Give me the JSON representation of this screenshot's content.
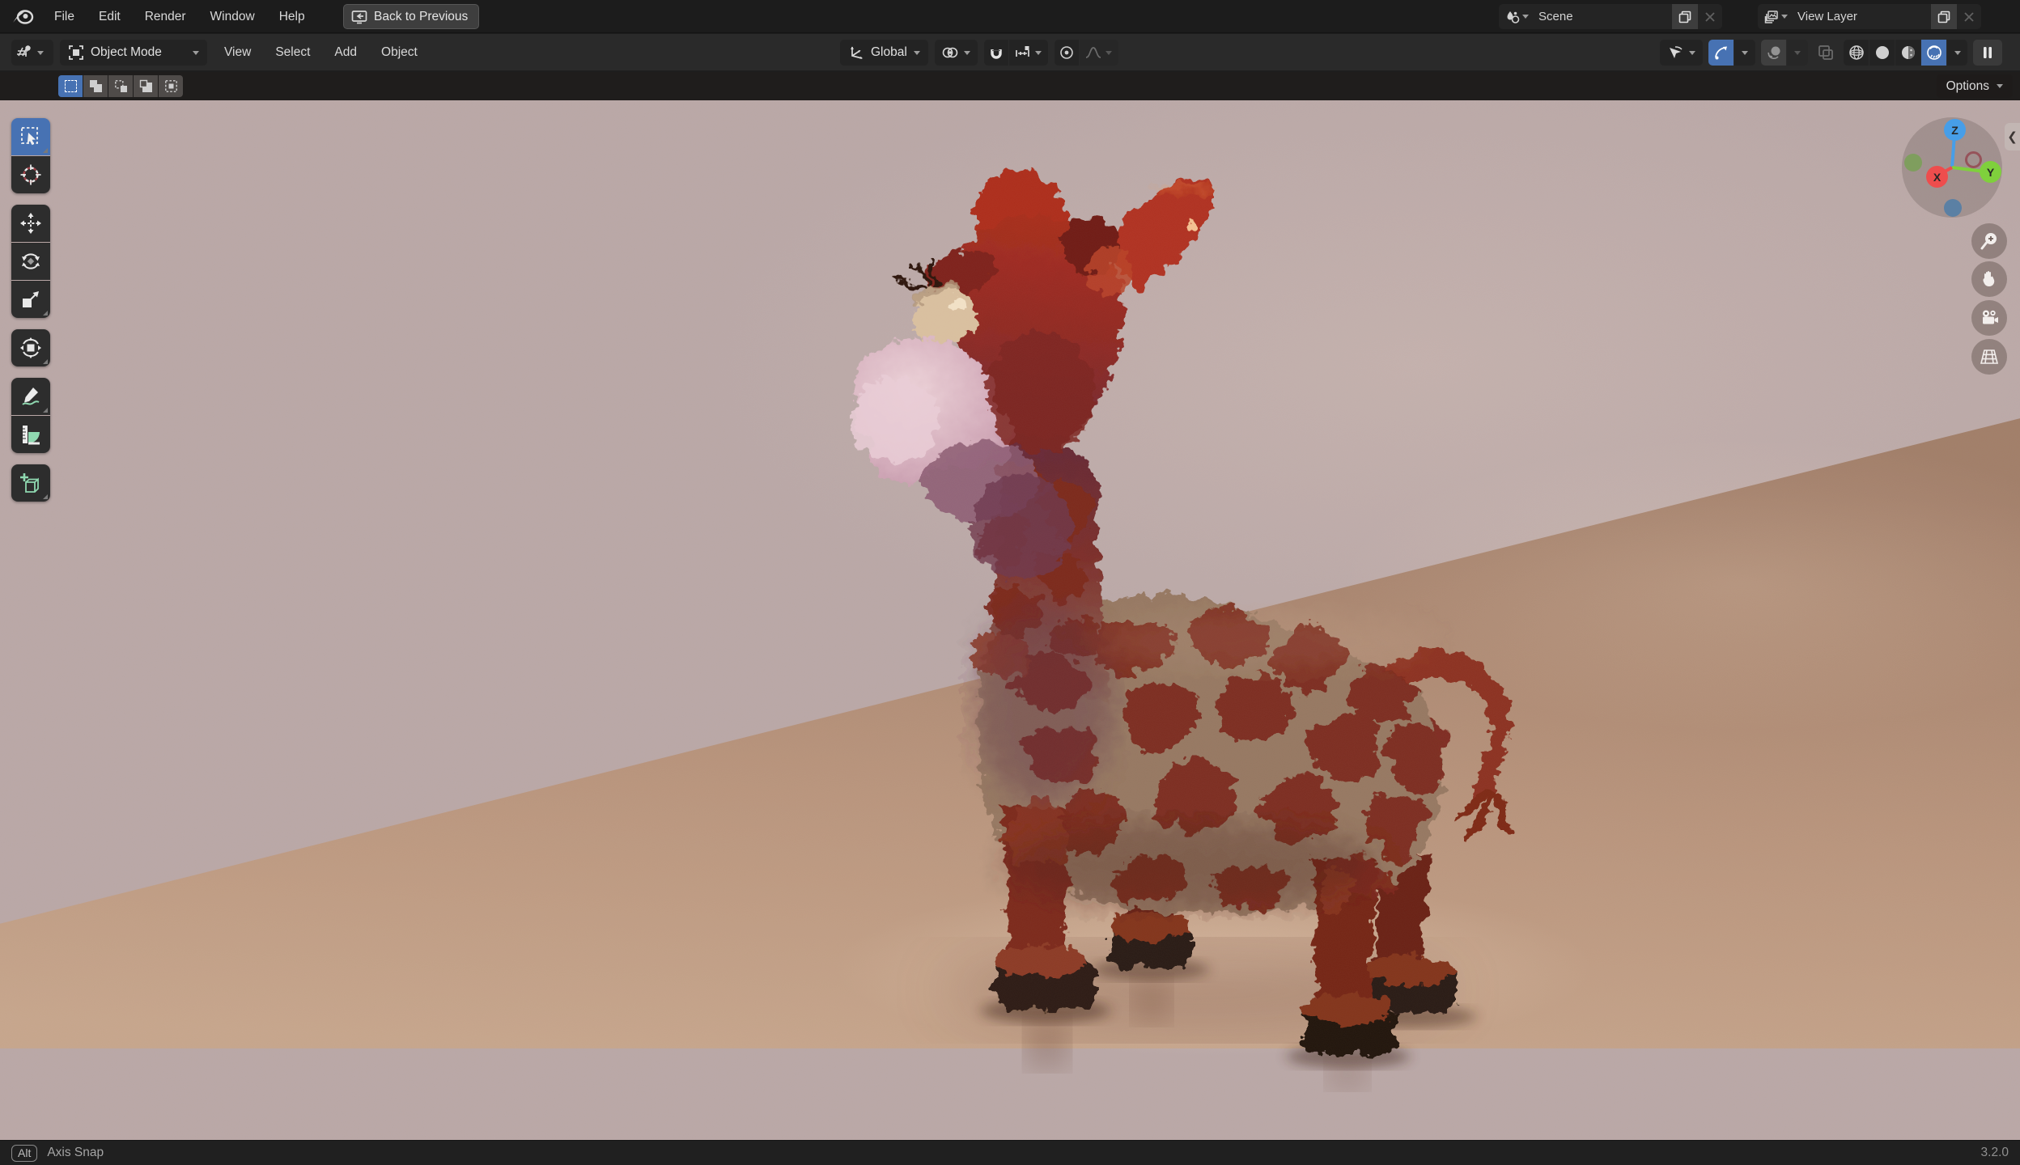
{
  "topbar": {
    "menus": [
      {
        "label": "File"
      },
      {
        "label": "Edit"
      },
      {
        "label": "Render"
      },
      {
        "label": "Window"
      },
      {
        "label": "Help"
      }
    ],
    "back_button_label": "Back to Previous",
    "scene_selector": {
      "value": "Scene"
    },
    "view_layer_selector": {
      "value": "View Layer"
    }
  },
  "viewport_header": {
    "editor_mode": "Object Mode",
    "menus": [
      {
        "label": "View"
      },
      {
        "label": "Select"
      },
      {
        "label": "Add"
      },
      {
        "label": "Object"
      }
    ],
    "transform_orientation": "Global"
  },
  "tool_settings": {
    "options_label": "Options"
  },
  "nav_gizmo": {
    "x_label": "X",
    "y_label": "Y",
    "z_label": "Z"
  },
  "status_bar": {
    "key_badge": "Alt",
    "hint": "Axis Snap",
    "version": "3.2.0"
  },
  "colors": {
    "accent_blue": "#4772b3",
    "tool_icon_green": "#86d2ae",
    "axis_x_red": "#ee4d4d",
    "axis_y_green": "#7fd03c",
    "axis_z_blue": "#479ee8",
    "viewport_wall": "#b9a7a6",
    "viewport_floor": "#b8957d",
    "giraffe_fur_red": "#8c2f1f"
  }
}
